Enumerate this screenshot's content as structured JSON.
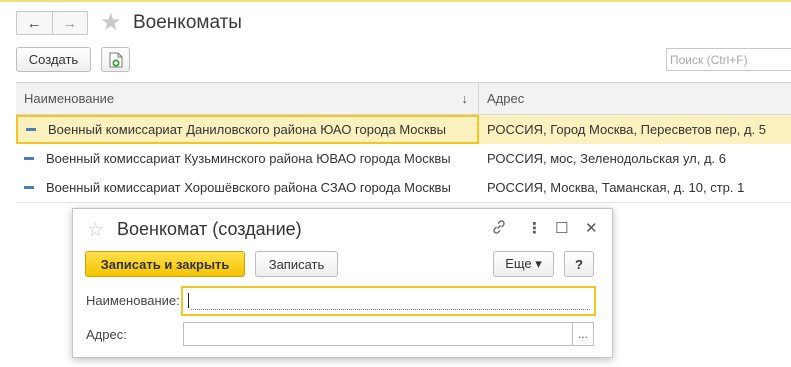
{
  "header": {
    "back_icon": "←",
    "forward_icon": "→",
    "favorite_icon": "★",
    "title": "Военкоматы"
  },
  "toolbar": {
    "create_label": "Создать",
    "search_placeholder": "Поиск (Ctrl+F)"
  },
  "table": {
    "columns": {
      "name": "Наименование",
      "sort_icon": "↓",
      "address": "Адрес"
    },
    "rows": [
      {
        "name": "Военный комиссариат Даниловского района ЮАО города Москвы",
        "address": "РОССИЯ, Город Москва, Пересветов пер, д. 5"
      },
      {
        "name": "Военный комиссариат Кузьминского района ЮВАО города Москвы",
        "address": "РОССИЯ, мос, Зеленодольская ул, д. 6"
      },
      {
        "name": "Военный комиссариат Хорошёвского района СЗАО города Москвы",
        "address": "РОССИЯ, Москва, Таманская, д. 10, стр. 1"
      }
    ]
  },
  "dialog": {
    "favorite_icon": "☆",
    "title": "Военкомат (создание)",
    "link_icon": "🔗",
    "menu_icon": "⋮",
    "maximize_icon": "☐",
    "close_icon": "✕",
    "save_close_label": "Записать и закрыть",
    "save_label": "Записать",
    "more_label": "Еще ▾",
    "help_label": "?",
    "name_label": "Наименование:",
    "name_value": "",
    "address_label": "Адрес:",
    "address_value": "",
    "select_button": "..."
  },
  "colors": {
    "accent_yellow": "#f5c524",
    "selected_row": "#fbf1be",
    "row_marker": "#4b7fb5"
  }
}
